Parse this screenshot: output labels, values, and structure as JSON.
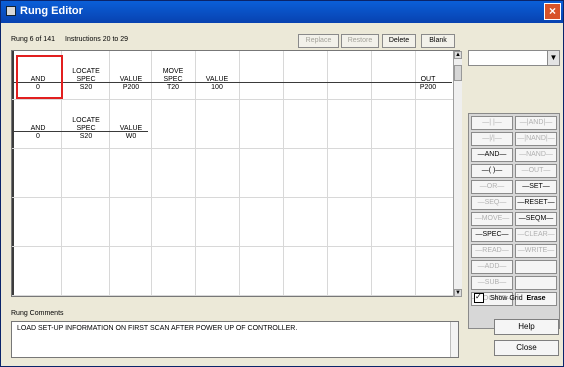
{
  "window": {
    "title": "Rung Editor",
    "close_label": "×"
  },
  "toolbar": {
    "rung_info": "Rung 6 of 141",
    "instructions_info": "Instructions 20 to 29",
    "buttons": [
      {
        "label": "Replace",
        "enabled": false
      },
      {
        "label": "Restore",
        "enabled": false
      },
      {
        "label": "Delete",
        "enabled": true
      },
      {
        "label": "Blank",
        "enabled": true
      }
    ]
  },
  "ladder": {
    "row1": [
      {
        "top": "",
        "mid": "AND",
        "bot": "0"
      },
      {
        "top": "LOCATE",
        "mid": "SPEC",
        "bot": "S20"
      },
      {
        "top": "",
        "mid": "VALUE",
        "bot": "P200"
      },
      {
        "top": "MOVE",
        "mid": "SPEC",
        "bot": "T20"
      },
      {
        "top": "",
        "mid": "VALUE",
        "bot": "100"
      },
      {
        "top": "",
        "mid": "OUT",
        "bot": "P200"
      }
    ],
    "row2": [
      {
        "top": "",
        "mid": "AND",
        "bot": "0"
      },
      {
        "top": "LOCATE",
        "mid": "SPEC",
        "bot": "S20"
      },
      {
        "top": "",
        "mid": "VALUE",
        "bot": "W0"
      }
    ]
  },
  "palette": {
    "buttons": [
      {
        "label": "—|  |—",
        "enabled": false
      },
      {
        "label": "—|AND|—",
        "enabled": false
      },
      {
        "label": "—|/|—",
        "enabled": false
      },
      {
        "label": "—|NAND|—",
        "enabled": false
      },
      {
        "label": "—AND—",
        "enabled": true
      },
      {
        "label": "—NAND—",
        "enabled": false
      },
      {
        "label": "—( )—",
        "enabled": true
      },
      {
        "label": "—OUT—",
        "enabled": false
      },
      {
        "label": "—OR—",
        "enabled": false
      },
      {
        "label": "—SET—",
        "enabled": true
      },
      {
        "label": "—SEQ—",
        "enabled": false
      },
      {
        "label": "—RESET—",
        "enabled": true
      },
      {
        "label": "—MOVE—",
        "enabled": false
      },
      {
        "label": "—SEQM—",
        "enabled": true
      },
      {
        "label": "—SPEC—",
        "enabled": true
      },
      {
        "label": "—CLEAR—",
        "enabled": false
      },
      {
        "label": "—READ—",
        "enabled": false
      },
      {
        "label": "—WRITE—",
        "enabled": false
      },
      {
        "label": "—ADD—",
        "enabled": false
      },
      {
        "label": "",
        "enabled": false
      },
      {
        "label": "—SUB—",
        "enabled": false
      },
      {
        "label": "",
        "enabled": false
      },
      {
        "label": "—LOCATE—",
        "enabled": false
      },
      {
        "label": "Erase",
        "enabled": true
      }
    ]
  },
  "show_grid": {
    "label": "Show Grid",
    "checked": true
  },
  "comments": {
    "label": "Rung Comments",
    "text": "LOAD SET-UP INFORMATION ON FIRST SCAN AFTER POWER UP OF CONTROLLER."
  },
  "buttons": {
    "help": "Help",
    "close": "Close"
  }
}
